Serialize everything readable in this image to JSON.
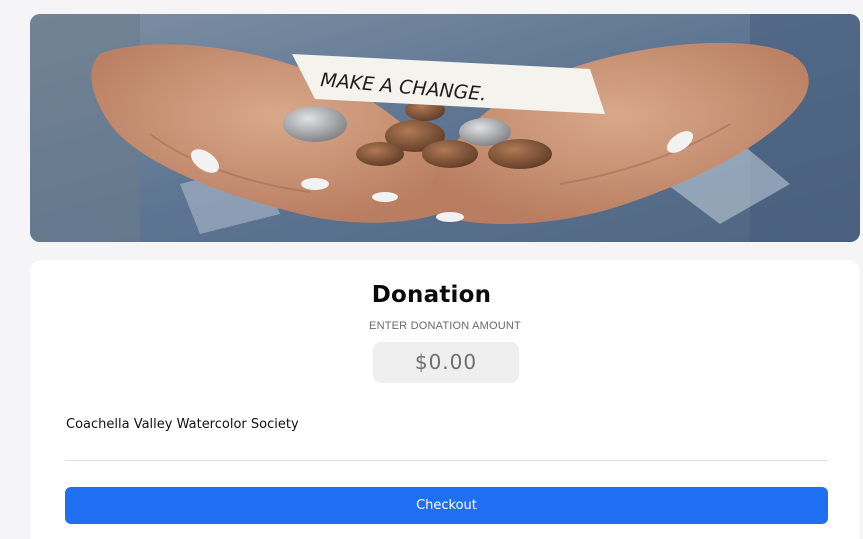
{
  "hero": {
    "image": "hands-holding-coins-photo",
    "sign_text": "MAKE A CHANGE."
  },
  "donation": {
    "title": "Donation",
    "subtitle": "ENTER DONATION AMOUNT",
    "amount_value": "$0.00",
    "organization": "Coachella Valley Watercolor Society",
    "checkout_label": "Checkout"
  },
  "colors": {
    "accent": "#1f6ff2",
    "card_background": "#ffffff",
    "page_background": "#f5f5f7",
    "amount_background": "#efefef"
  }
}
